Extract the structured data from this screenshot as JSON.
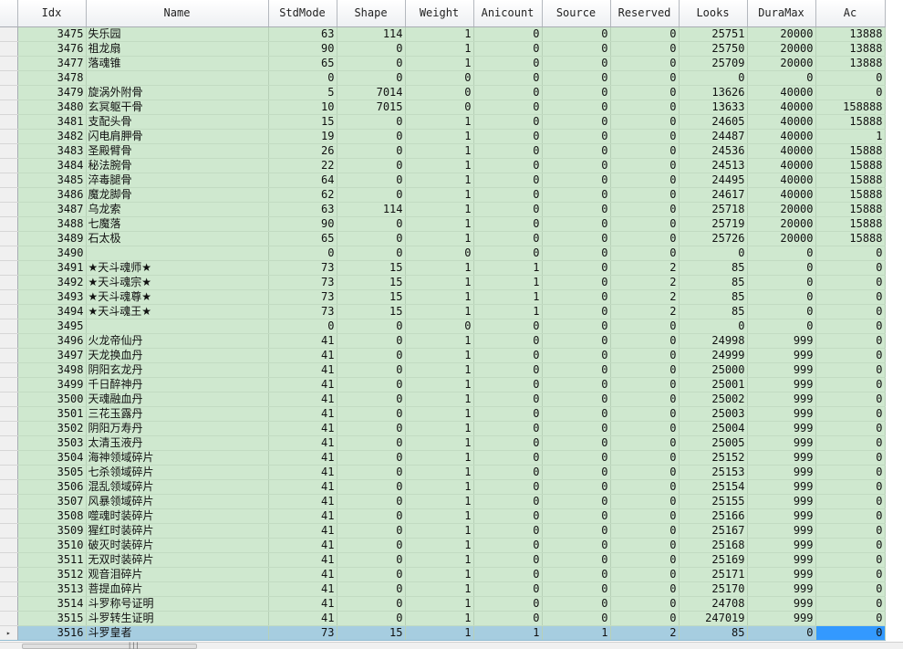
{
  "columns": [
    "Idx",
    "Name",
    "StdMode",
    "Shape",
    "Weight",
    "Anicount",
    "Source",
    "Reserved",
    "Looks",
    "DuraMax",
    "Ac"
  ],
  "row_indicator": "▸",
  "scrollbar_grip": "|||",
  "rows": [
    [
      "3475",
      "失乐园",
      "63",
      "114",
      "1",
      "0",
      "0",
      "0",
      "25751",
      "20000",
      "13888"
    ],
    [
      "3476",
      "祖龙扇",
      "90",
      "0",
      "1",
      "0",
      "0",
      "0",
      "25750",
      "20000",
      "13888"
    ],
    [
      "3477",
      "落魂锥",
      "65",
      "0",
      "1",
      "0",
      "0",
      "0",
      "25709",
      "20000",
      "13888"
    ],
    [
      "3478",
      "",
      "0",
      "0",
      "0",
      "0",
      "0",
      "0",
      "0",
      "0",
      "0"
    ],
    [
      "3479",
      "旋涡外附骨",
      "5",
      "7014",
      "0",
      "0",
      "0",
      "0",
      "13626",
      "40000",
      "0"
    ],
    [
      "3480",
      "玄冥躯干骨",
      "10",
      "7015",
      "0",
      "0",
      "0",
      "0",
      "13633",
      "40000",
      "158888"
    ],
    [
      "3481",
      "支配头骨",
      "15",
      "0",
      "1",
      "0",
      "0",
      "0",
      "24605",
      "40000",
      "15888"
    ],
    [
      "3482",
      "闪电肩胛骨",
      "19",
      "0",
      "1",
      "0",
      "0",
      "0",
      "24487",
      "40000",
      "1"
    ],
    [
      "3483",
      "圣殿臂骨",
      "26",
      "0",
      "1",
      "0",
      "0",
      "0",
      "24536",
      "40000",
      "15888"
    ],
    [
      "3484",
      "秘法腕骨",
      "22",
      "0",
      "1",
      "0",
      "0",
      "0",
      "24513",
      "40000",
      "15888"
    ],
    [
      "3485",
      "淬毒腿骨",
      "64",
      "0",
      "1",
      "0",
      "0",
      "0",
      "24495",
      "40000",
      "15888"
    ],
    [
      "3486",
      "魔龙脚骨",
      "62",
      "0",
      "1",
      "0",
      "0",
      "0",
      "24617",
      "40000",
      "15888"
    ],
    [
      "3487",
      "乌龙索",
      "63",
      "114",
      "1",
      "0",
      "0",
      "0",
      "25718",
      "20000",
      "15888"
    ],
    [
      "3488",
      "七魔落",
      "90",
      "0",
      "1",
      "0",
      "0",
      "0",
      "25719",
      "20000",
      "15888"
    ],
    [
      "3489",
      "石太极",
      "65",
      "0",
      "1",
      "0",
      "0",
      "0",
      "25726",
      "20000",
      "15888"
    ],
    [
      "3490",
      "",
      "0",
      "0",
      "0",
      "0",
      "0",
      "0",
      "0",
      "0",
      "0"
    ],
    [
      "3491",
      "★天斗魂师★",
      "73",
      "15",
      "1",
      "1",
      "0",
      "2",
      "85",
      "0",
      "0"
    ],
    [
      "3492",
      "★天斗魂宗★",
      "73",
      "15",
      "1",
      "1",
      "0",
      "2",
      "85",
      "0",
      "0"
    ],
    [
      "3493",
      "★天斗魂尊★",
      "73",
      "15",
      "1",
      "1",
      "0",
      "2",
      "85",
      "0",
      "0"
    ],
    [
      "3494",
      "★天斗魂王★",
      "73",
      "15",
      "1",
      "1",
      "0",
      "2",
      "85",
      "0",
      "0"
    ],
    [
      "3495",
      "",
      "0",
      "0",
      "0",
      "0",
      "0",
      "0",
      "0",
      "0",
      "0"
    ],
    [
      "3496",
      "火龙帝仙丹",
      "41",
      "0",
      "1",
      "0",
      "0",
      "0",
      "24998",
      "999",
      "0"
    ],
    [
      "3497",
      "天龙换血丹",
      "41",
      "0",
      "1",
      "0",
      "0",
      "0",
      "24999",
      "999",
      "0"
    ],
    [
      "3498",
      "阴阳玄龙丹",
      "41",
      "0",
      "1",
      "0",
      "0",
      "0",
      "25000",
      "999",
      "0"
    ],
    [
      "3499",
      "千日醉神丹",
      "41",
      "0",
      "1",
      "0",
      "0",
      "0",
      "25001",
      "999",
      "0"
    ],
    [
      "3500",
      "天魂融血丹",
      "41",
      "0",
      "1",
      "0",
      "0",
      "0",
      "25002",
      "999",
      "0"
    ],
    [
      "3501",
      "三花玉露丹",
      "41",
      "0",
      "1",
      "0",
      "0",
      "0",
      "25003",
      "999",
      "0"
    ],
    [
      "3502",
      "阴阳万寿丹",
      "41",
      "0",
      "1",
      "0",
      "0",
      "0",
      "25004",
      "999",
      "0"
    ],
    [
      "3503",
      "太清玉液丹",
      "41",
      "0",
      "1",
      "0",
      "0",
      "0",
      "25005",
      "999",
      "0"
    ],
    [
      "3504",
      "海神领域碎片",
      "41",
      "0",
      "1",
      "0",
      "0",
      "0",
      "25152",
      "999",
      "0"
    ],
    [
      "3505",
      "七杀领域碎片",
      "41",
      "0",
      "1",
      "0",
      "0",
      "0",
      "25153",
      "999",
      "0"
    ],
    [
      "3506",
      "混乱领域碎片",
      "41",
      "0",
      "1",
      "0",
      "0",
      "0",
      "25154",
      "999",
      "0"
    ],
    [
      "3507",
      "风暴领域碎片",
      "41",
      "0",
      "1",
      "0",
      "0",
      "0",
      "25155",
      "999",
      "0"
    ],
    [
      "3508",
      "噬魂时装碎片",
      "41",
      "0",
      "1",
      "0",
      "0",
      "0",
      "25166",
      "999",
      "0"
    ],
    [
      "3509",
      "猩红时装碎片",
      "41",
      "0",
      "1",
      "0",
      "0",
      "0",
      "25167",
      "999",
      "0"
    ],
    [
      "3510",
      "破灭时装碎片",
      "41",
      "0",
      "1",
      "0",
      "0",
      "0",
      "25168",
      "999",
      "0"
    ],
    [
      "3511",
      "无双时装碎片",
      "41",
      "0",
      "1",
      "0",
      "0",
      "0",
      "25169",
      "999",
      "0"
    ],
    [
      "3512",
      "观音泪碎片",
      "41",
      "0",
      "1",
      "0",
      "0",
      "0",
      "25171",
      "999",
      "0"
    ],
    [
      "3513",
      "菩提血碎片",
      "41",
      "0",
      "1",
      "0",
      "0",
      "0",
      "25170",
      "999",
      "0"
    ],
    [
      "3514",
      "斗罗称号证明",
      "41",
      "0",
      "1",
      "0",
      "0",
      "0",
      "24708",
      "999",
      "0"
    ],
    [
      "3515",
      "斗罗转生证明",
      "41",
      "0",
      "1",
      "0",
      "0",
      "0",
      "247019",
      "999",
      "0"
    ],
    [
      "3516",
      "斗罗皇者",
      "73",
      "15",
      "1",
      "1",
      "1",
      "2",
      "85",
      "0",
      "0"
    ]
  ],
  "selected_row_index": 41,
  "colors": {
    "row_background": "#cfe8cf",
    "selected_row": "#a6cde0",
    "current_cell": "#3399ff",
    "header_background": "#eef0f3"
  }
}
